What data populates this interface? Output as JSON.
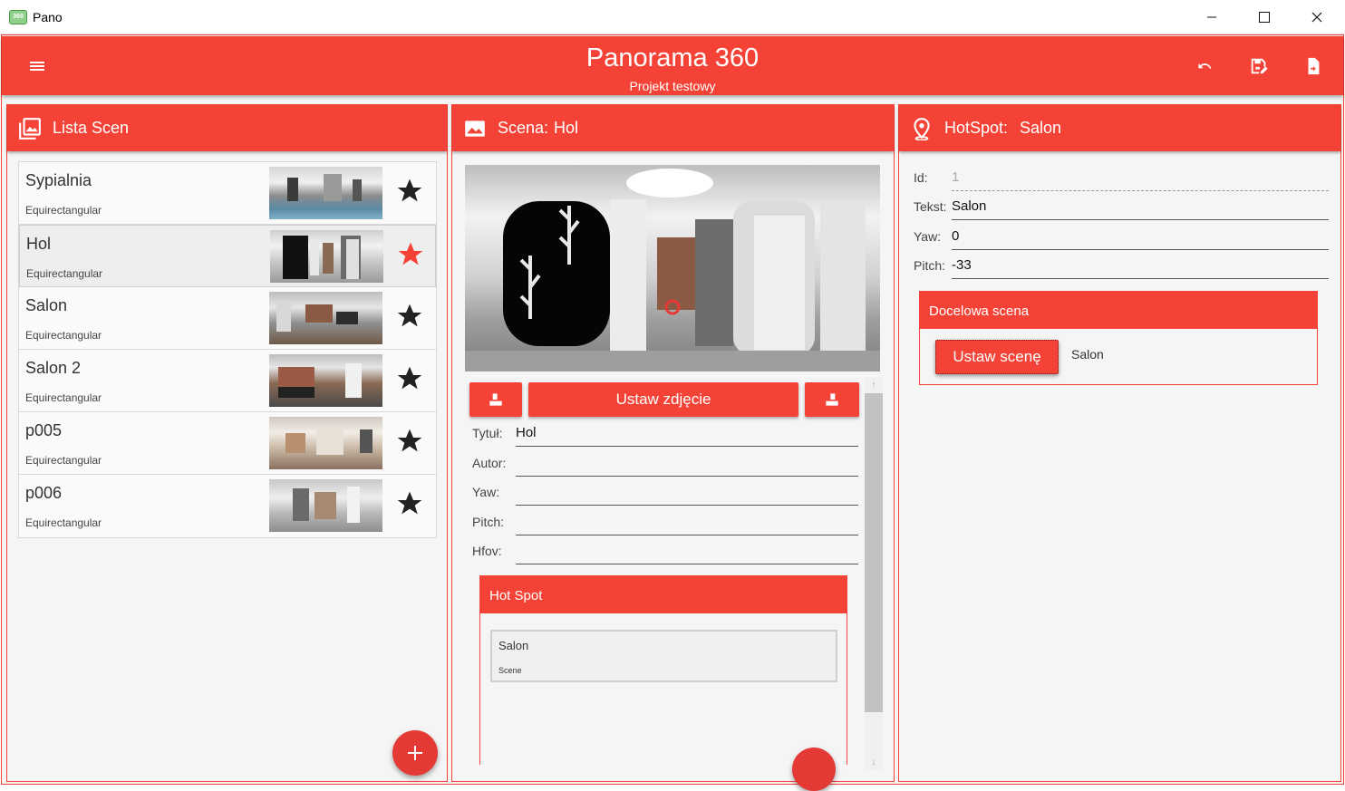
{
  "window": {
    "title": "Pano",
    "app_icon_text": "360"
  },
  "header": {
    "title": "Panorama 360",
    "subtitle": "Projekt testowy"
  },
  "scene_list_panel": {
    "title": "Lista Scen",
    "scenes": [
      {
        "name": "Sypialnia",
        "type": "Equirectangular",
        "favorite": false
      },
      {
        "name": "Hol",
        "type": "Equirectangular",
        "favorite": true
      },
      {
        "name": "Salon",
        "type": "Equirectangular",
        "favorite": false
      },
      {
        "name": "Salon 2",
        "type": "Equirectangular",
        "favorite": false
      },
      {
        "name": "p005",
        "type": "Equirectangular",
        "favorite": false
      },
      {
        "name": "p006",
        "type": "Equirectangular",
        "favorite": false
      }
    ]
  },
  "scene_panel": {
    "title_prefix": "Scena:",
    "title_name": "Hol",
    "set_photo_label": "Ustaw zdjęcie",
    "fields": {
      "title_label": "Tytuł:",
      "title_value": "Hol",
      "author_label": "Autor:",
      "author_value": "",
      "yaw_label": "Yaw:",
      "yaw_value": "",
      "pitch_label": "Pitch:",
      "pitch_value": "",
      "hfov_label": "Hfov:",
      "hfov_value": ""
    },
    "hotspot_section": {
      "title": "Hot Spot",
      "items": [
        {
          "name": "Salon",
          "type": "Scene"
        }
      ]
    }
  },
  "hotspot_panel": {
    "title_prefix": "HotSpot:",
    "title_name": "Salon",
    "fields": {
      "id_label": "Id:",
      "id_value": "1",
      "text_label": "Tekst:",
      "text_value": "Salon",
      "yaw_label": "Yaw:",
      "yaw_value": "0",
      "pitch_label": "Pitch:",
      "pitch_value": "-33"
    },
    "target": {
      "title": "Docelowa scena",
      "set_scene_label": "Ustaw scenę",
      "scene_name": "Salon"
    }
  },
  "colors": {
    "accent": "#f44336",
    "favorite_star": "#f44336",
    "star": "#222222"
  }
}
